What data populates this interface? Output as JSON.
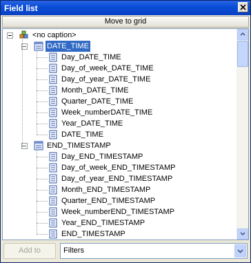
{
  "window": {
    "title": "Field list"
  },
  "toolbar": {
    "move_to_grid": "Move to grid"
  },
  "tree": {
    "root": "<no caption>",
    "groups": [
      {
        "label": "DATE_TIME",
        "selected": true,
        "items": [
          "Day_DATE_TIME",
          "Day_of_week_DATE_TIME",
          "Day_of_year_DATE_TIME",
          "Month_DATE_TIME",
          "Quarter_DATE_TIME",
          "Week_numberDATE_TIME",
          "Year_DATE_TIME",
          "DATE_TIME"
        ]
      },
      {
        "label": "END_TIMESTAMP",
        "selected": false,
        "items": [
          "Day_END_TIMESTAMP",
          "Day_of_week_END_TIMESTAMP",
          "Day_of_year_END_TIMESTAMP",
          "Month_END_TIMESTAMP",
          "Quarter_END_TIMESTAMP",
          "Week_numberEND_TIMESTAMP",
          "Year_END_TIMESTAMP",
          "END_TIMESTAMP"
        ]
      }
    ]
  },
  "bottom": {
    "add_to": "Add to",
    "area_selected": "Filters"
  },
  "icons": {
    "close": "close-icon",
    "cube": "cube-icon",
    "dimension": "dimension-icon",
    "field": "field-icon",
    "expand": "collapse-icon",
    "scroll_up": "arrow-up-icon",
    "scroll_down": "arrow-down-icon",
    "combo": "chevron-down-icon"
  },
  "colors": {
    "title_bar": "#0a4fd8",
    "selection": "#316ac5"
  }
}
